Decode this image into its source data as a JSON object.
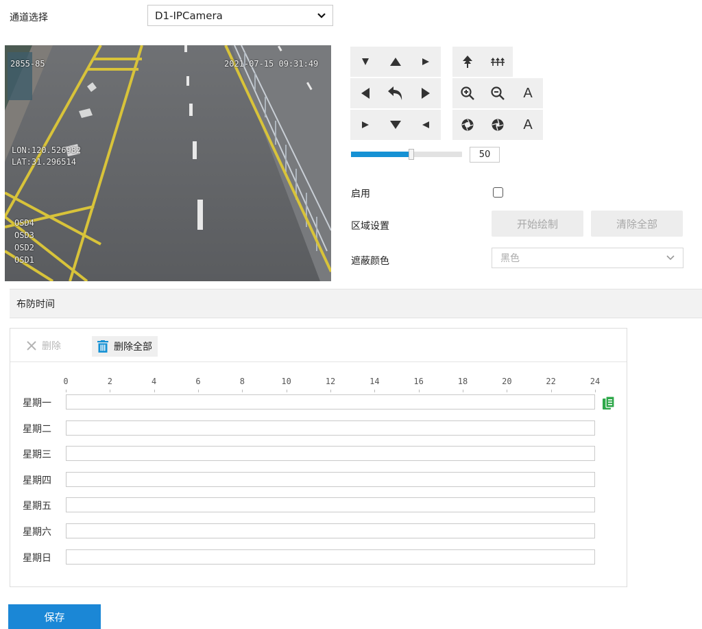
{
  "channel": {
    "label": "通道选择",
    "value": "D1-IPCamera"
  },
  "video": {
    "osd_top_left": "2855-85",
    "osd_timestamp": "2021-07-15 09:31:49",
    "osd_lon": "LON:120.526982",
    "osd_lat": "LAT:31.296514",
    "osd_lines": [
      "OSD4",
      "OSD3",
      "OSD2",
      "OSD1"
    ]
  },
  "ptz": {
    "buttons": [
      {
        "id": "up-left",
        "icon": "arrow-up-left-icon"
      },
      {
        "id": "up",
        "icon": "arrow-up-icon"
      },
      {
        "id": "up-right",
        "icon": "arrow-up-right-icon"
      },
      {
        "id": "left",
        "icon": "arrow-left-icon"
      },
      {
        "id": "home",
        "icon": "return-icon"
      },
      {
        "id": "right",
        "icon": "arrow-right-icon"
      },
      {
        "id": "down-left",
        "icon": "arrow-down-left-icon"
      },
      {
        "id": "down",
        "icon": "arrow-down-icon"
      },
      {
        "id": "down-right",
        "icon": "arrow-down-right-icon"
      },
      {
        "id": "focus-near",
        "icon": "focus-near-icon"
      },
      {
        "id": "focus-far",
        "icon": "focus-far-icon"
      },
      {
        "id": "zoom-in",
        "icon": "zoom-in-icon"
      },
      {
        "id": "zoom-out",
        "icon": "zoom-out-icon"
      },
      {
        "id": "auto-focus",
        "icon": "auto-icon",
        "text": "A"
      },
      {
        "id": "iris-open",
        "icon": "iris-open-icon"
      },
      {
        "id": "iris-close",
        "icon": "iris-close-icon"
      },
      {
        "id": "auto-iris",
        "icon": "auto-icon",
        "text": "A"
      }
    ],
    "speed_value": "50",
    "speed_fraction": 0.5
  },
  "enable": {
    "label": "启用",
    "checked": false
  },
  "area": {
    "label": "区域设置",
    "start_draw": "开始绘制",
    "clear_all": "清除全部"
  },
  "mask_color": {
    "label": "遮蔽颜色",
    "value": "黑色"
  },
  "schedule": {
    "title": "布防时间",
    "delete_label": "删除",
    "delete_all_label": "删除全部",
    "hours": [
      "0",
      "2",
      "4",
      "6",
      "8",
      "10",
      "12",
      "14",
      "16",
      "18",
      "20",
      "22",
      "24"
    ],
    "days": [
      "星期一",
      "星期二",
      "星期三",
      "星期四",
      "星期五",
      "星期六",
      "星期日"
    ],
    "accent": "#1591d4",
    "copy_icon_color": "#2ea84a"
  },
  "save_label": "保存"
}
